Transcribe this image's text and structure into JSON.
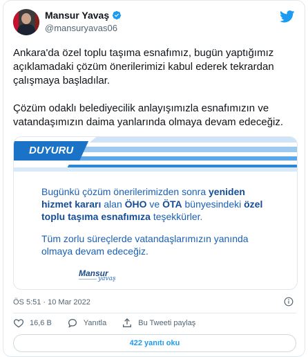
{
  "colors": {
    "twitter_blue": "#1d9bf0",
    "duyuru_blue": "#1a73c7",
    "text_primary": "#0f1419",
    "text_secondary": "#536471"
  },
  "author": {
    "name": "Mansur Yavaş",
    "handle": "@mansuryavas06",
    "verified": true
  },
  "tweet": {
    "paragraphs": [
      "Ankara'da özel toplu taşıma esnafımız, bugün yaptığımız açıklamadaki çözüm önerilerimizi kabul ederek tekrardan çalışmaya başladılar.",
      "Çözüm odaklı belediyecilik anlayışımızla esnafımızın ve vatandaşımızın daima yanlarında olmaya devam edeceğiz."
    ],
    "timestamp": "ÖS 5:51 · 10 Mar 2022"
  },
  "media": {
    "banner_label": "DUYURU",
    "line1_pre": "Bugünkü çözüm önerilerimizden sonra ",
    "line1_bold": "yeniden hizmet kararı",
    "line1_mid": " alan ",
    "line1_oho": "ÖHO",
    "line1_and": " ve ",
    "line1_ota": "ÖTA",
    "line1_post": " bünyesindeki ",
    "line1_bold2": "özel toplu taşıma esnafımıza",
    "line1_end": " teşekkürler.",
    "line2": "Tüm zorlu süreçlerde vatandaşlarımızın yanında olmaya devam edeceğiz.",
    "signature_name": "Mansur",
    "signature_script": "yavaş"
  },
  "actions": {
    "likes": "16,6 B",
    "reply_label": "Yanıtla",
    "share_label": "Bu Tweeti paylaş"
  },
  "replies_button": "422 yanıtı oku",
  "icons": {
    "logo": "twitter-bird-icon",
    "verified": "verified-badge-icon",
    "info": "info-icon",
    "like": "heart-icon",
    "reply": "reply-icon",
    "share": "share-icon"
  }
}
